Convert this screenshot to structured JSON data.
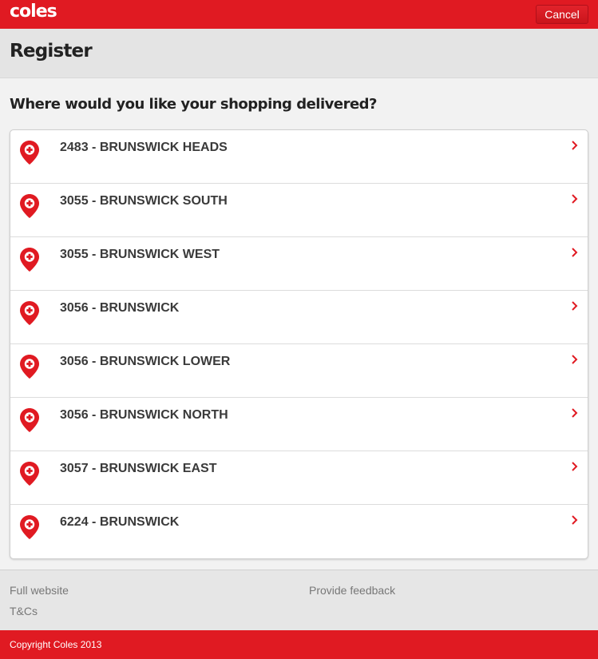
{
  "header": {
    "logo_text": "coles",
    "cancel_label": "Cancel",
    "brand_color": "#e01a22"
  },
  "page": {
    "title": "Register",
    "question": "Where would you like your shopping delivered?"
  },
  "locations": [
    {
      "label": "2483 - BRUNSWICK HEADS",
      "icon": "location-pin-icon"
    },
    {
      "label": "3055 - BRUNSWICK SOUTH",
      "icon": "location-pin-icon"
    },
    {
      "label": "3055 - BRUNSWICK WEST",
      "icon": "location-pin-icon"
    },
    {
      "label": "3056 - BRUNSWICK",
      "icon": "location-pin-icon"
    },
    {
      "label": "3056 - BRUNSWICK LOWER",
      "icon": "location-pin-icon"
    },
    {
      "label": "3056 - BRUNSWICK NORTH",
      "icon": "location-pin-icon"
    },
    {
      "label": "3057 - BRUNSWICK EAST",
      "icon": "location-pin-icon"
    },
    {
      "label": "6224 - BRUNSWICK",
      "icon": "location-pin-icon"
    }
  ],
  "footer": {
    "full_website": "Full website",
    "feedback": "Provide feedback",
    "terms": "T&Cs",
    "copyright": "Copyright Coles 2013"
  }
}
